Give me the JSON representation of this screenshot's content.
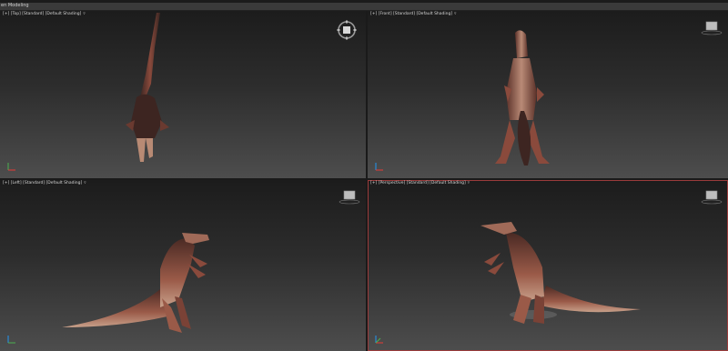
{
  "ribbon": {
    "label": "en Modeling"
  },
  "viewports": [
    {
      "label": "[+] [Top] [Standard] [Default Shading]",
      "filter_icon": "filter-funnel-icon",
      "active": false
    },
    {
      "label": "[+] [Front] [Standard] [Default Shading]",
      "filter_icon": "filter-funnel-icon",
      "active": false
    },
    {
      "label": "[+] [Left] [Standard] [Default Shading]",
      "filter_icon": "filter-funnel-icon",
      "active": false
    },
    {
      "label": "[+] [Perspective] [Standard] [Default Shading]",
      "filter_icon": "filter-funnel-icon",
      "active": true
    }
  ],
  "colors": {
    "active_border": "#9a3b3b",
    "viewport_top": "#1c1c1c",
    "viewport_bottom": "#4d4d4d",
    "model_skin": "#8a4a3c",
    "model_dark": "#3a2622"
  }
}
